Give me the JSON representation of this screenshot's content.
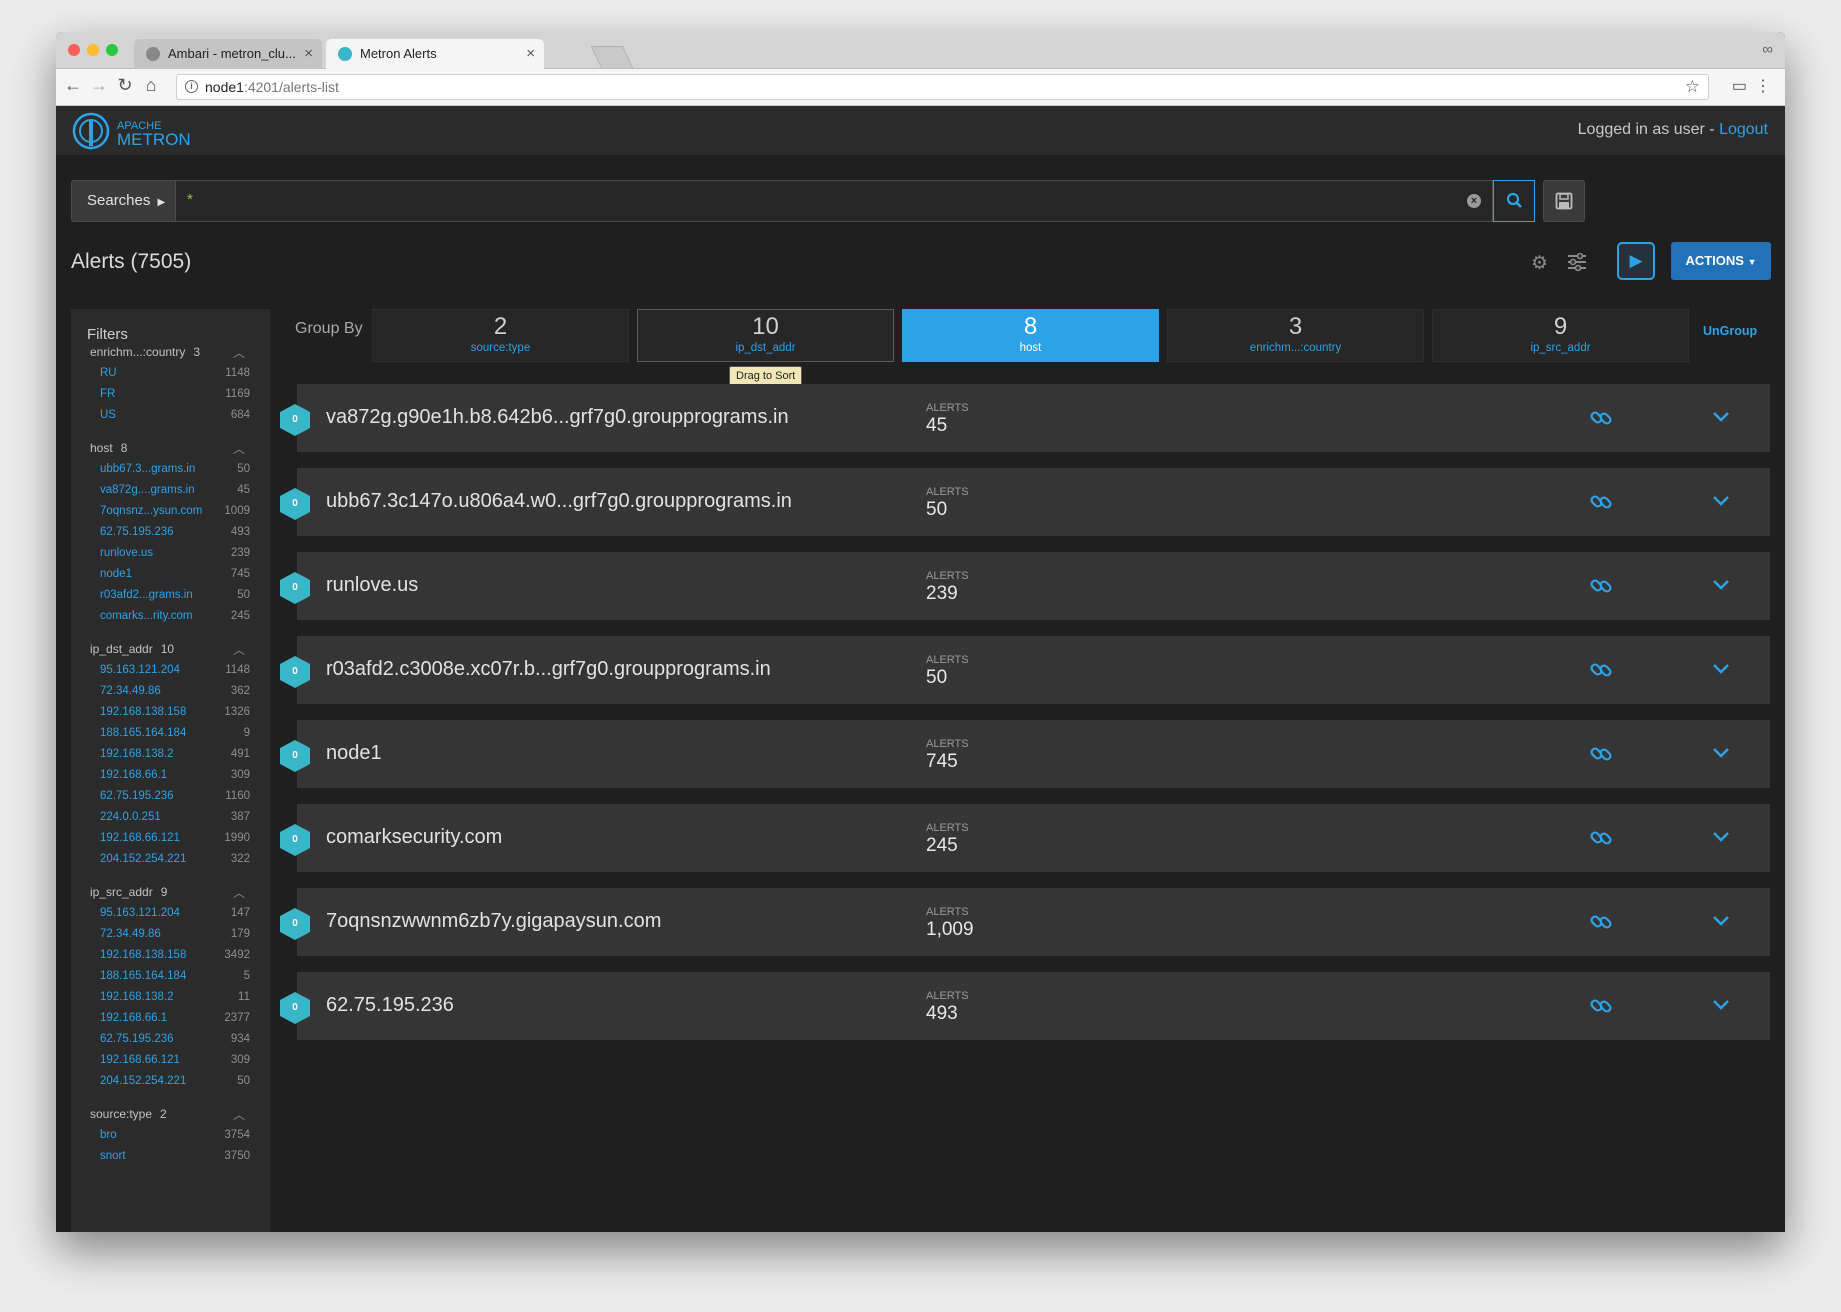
{
  "browser": {
    "tabs": [
      {
        "label": "Ambari - metron_clu...",
        "active": false
      },
      {
        "label": "Metron Alerts",
        "active": true
      }
    ],
    "url_host": "node1",
    "url_path": ":4201/alerts-list"
  },
  "header": {
    "logo_top": "APACHE",
    "logo_bottom": "METRON",
    "logged_in": "Logged in as user - ",
    "logout": "Logout"
  },
  "search": {
    "searches_label": "Searches",
    "query": "*"
  },
  "alerts": {
    "title": "Alerts (7505)",
    "actions_label": "ACTIONS"
  },
  "filters": {
    "title": "Filters",
    "groups": [
      {
        "name": "enrichm...:country",
        "count": "3",
        "items": [
          {
            "label": "RU",
            "value": "1148"
          },
          {
            "label": "FR",
            "value": "1169"
          },
          {
            "label": "US",
            "value": "684"
          }
        ]
      },
      {
        "name": "host",
        "count": "8",
        "items": [
          {
            "label": "ubb67.3...grams.in",
            "value": "50"
          },
          {
            "label": "va872g....grams.in",
            "value": "45"
          },
          {
            "label": "7oqnsnz...ysun.com",
            "value": "1009"
          },
          {
            "label": "62.75.195.236",
            "value": "493"
          },
          {
            "label": "runlove.us",
            "value": "239"
          },
          {
            "label": "node1",
            "value": "745"
          },
          {
            "label": "r03afd2...grams.in",
            "value": "50"
          },
          {
            "label": "comarks...rity.com",
            "value": "245"
          }
        ]
      },
      {
        "name": "ip_dst_addr",
        "count": "10",
        "items": [
          {
            "label": "95.163.121.204",
            "value": "1148"
          },
          {
            "label": "72.34.49.86",
            "value": "362"
          },
          {
            "label": "192.168.138.158",
            "value": "1326"
          },
          {
            "label": "188.165.164.184",
            "value": "9"
          },
          {
            "label": "192.168.138.2",
            "value": "491"
          },
          {
            "label": "192.168.66.1",
            "value": "309"
          },
          {
            "label": "62.75.195.236",
            "value": "1160"
          },
          {
            "label": "224.0.0.251",
            "value": "387"
          },
          {
            "label": "192.168.66.121",
            "value": "1990"
          },
          {
            "label": "204.152.254.221",
            "value": "322"
          }
        ]
      },
      {
        "name": "ip_src_addr",
        "count": "9",
        "items": [
          {
            "label": "95.163.121.204",
            "value": "147"
          },
          {
            "label": "72.34.49.86",
            "value": "179"
          },
          {
            "label": "192.168.138.158",
            "value": "3492"
          },
          {
            "label": "188.165.164.184",
            "value": "5"
          },
          {
            "label": "192.168.138.2",
            "value": "11"
          },
          {
            "label": "192.168.66.1",
            "value": "2377"
          },
          {
            "label": "62.75.195.236",
            "value": "934"
          },
          {
            "label": "192.168.66.121",
            "value": "309"
          },
          {
            "label": "204.152.254.221",
            "value": "50"
          }
        ]
      },
      {
        "name": "source:type",
        "count": "2",
        "items": [
          {
            "label": "bro",
            "value": "3754"
          },
          {
            "label": "snort",
            "value": "3750"
          }
        ]
      }
    ]
  },
  "group_by": {
    "label": "Group By",
    "tiles": [
      {
        "count": "2",
        "field": "source:type",
        "state": "normal"
      },
      {
        "count": "10",
        "field": "ip_dst_addr",
        "state": "drag"
      },
      {
        "count": "8",
        "field": "host",
        "state": "active"
      },
      {
        "count": "3",
        "field": "enrichm...:country",
        "state": "normal"
      },
      {
        "count": "9",
        "field": "ip_src_addr",
        "state": "normal"
      }
    ],
    "tooltip": "Drag to Sort",
    "ungroup_label": "UnGroup"
  },
  "alert_rows": [
    {
      "badge": "0",
      "name": "va872g.g90e1h.b8.642b6...grf7g0.groupprograms.in",
      "label": "ALERTS",
      "count": "45"
    },
    {
      "badge": "0",
      "name": "ubb67.3c147o.u806a4.w0...grf7g0.groupprograms.in",
      "label": "ALERTS",
      "count": "50"
    },
    {
      "badge": "0",
      "name": "runlove.us",
      "label": "ALERTS",
      "count": "239"
    },
    {
      "badge": "0",
      "name": "r03afd2.c3008e.xc07r.b...grf7g0.groupprograms.in",
      "label": "ALERTS",
      "count": "50"
    },
    {
      "badge": "0",
      "name": "node1",
      "label": "ALERTS",
      "count": "745"
    },
    {
      "badge": "0",
      "name": "comarksecurity.com",
      "label": "ALERTS",
      "count": "245"
    },
    {
      "badge": "0",
      "name": "7oqnsnzwwnm6zb7y.gigapaysun.com",
      "label": "ALERTS",
      "count": "1,009"
    },
    {
      "badge": "0",
      "name": "62.75.195.236",
      "label": "ALERTS",
      "count": "493"
    }
  ],
  "icons": {
    "link": "link-icon",
    "chevron": "chevron-down-icon",
    "settings": "gear-icon",
    "configure": "sliders-icon",
    "play": "play-icon",
    "save": "floppy-icon",
    "search": "search-icon"
  },
  "colors": {
    "accent": "#2ea2e6",
    "badge": "#3ab6c9",
    "actions": "#2172b8"
  }
}
